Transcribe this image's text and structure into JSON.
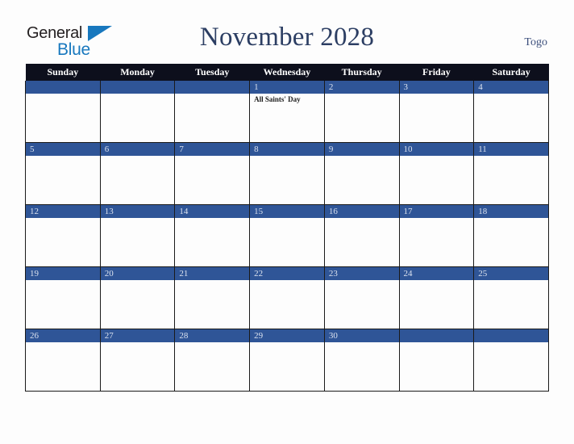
{
  "brand": {
    "name_part1": "General",
    "name_part2": "Blue",
    "logo_triangle_icon": "triangle-icon",
    "colors": {
      "general_text": "#231f20",
      "blue_text": "#1878be",
      "triangle": "#1878be"
    }
  },
  "header": {
    "title": "November 2028",
    "region": "Togo",
    "title_color": "#2c3e63",
    "region_color": "#3c4f7c"
  },
  "calendar": {
    "month": "November",
    "year": "2028",
    "weekday_headers": [
      "Sunday",
      "Monday",
      "Tuesday",
      "Wednesday",
      "Thursday",
      "Friday",
      "Saturday"
    ],
    "colors": {
      "header_background": "#0d0f1c",
      "header_text": "#ffffff",
      "daybar_background": "#2f5597",
      "daybar_text": "#dbe2ef",
      "cell_background": "#fdfdfd",
      "grid_line": "#1a1a1a",
      "event_text": "#1b1b1b"
    },
    "weeks": [
      [
        {
          "day": "",
          "events": []
        },
        {
          "day": "",
          "events": []
        },
        {
          "day": "",
          "events": []
        },
        {
          "day": "1",
          "events": [
            "All Saints' Day"
          ]
        },
        {
          "day": "2",
          "events": []
        },
        {
          "day": "3",
          "events": []
        },
        {
          "day": "4",
          "events": []
        }
      ],
      [
        {
          "day": "5",
          "events": []
        },
        {
          "day": "6",
          "events": []
        },
        {
          "day": "7",
          "events": []
        },
        {
          "day": "8",
          "events": []
        },
        {
          "day": "9",
          "events": []
        },
        {
          "day": "10",
          "events": []
        },
        {
          "day": "11",
          "events": []
        }
      ],
      [
        {
          "day": "12",
          "events": []
        },
        {
          "day": "13",
          "events": []
        },
        {
          "day": "14",
          "events": []
        },
        {
          "day": "15",
          "events": []
        },
        {
          "day": "16",
          "events": []
        },
        {
          "day": "17",
          "events": []
        },
        {
          "day": "18",
          "events": []
        }
      ],
      [
        {
          "day": "19",
          "events": []
        },
        {
          "day": "20",
          "events": []
        },
        {
          "day": "21",
          "events": []
        },
        {
          "day": "22",
          "events": []
        },
        {
          "day": "23",
          "events": []
        },
        {
          "day": "24",
          "events": []
        },
        {
          "day": "25",
          "events": []
        }
      ],
      [
        {
          "day": "26",
          "events": []
        },
        {
          "day": "27",
          "events": []
        },
        {
          "day": "28",
          "events": []
        },
        {
          "day": "29",
          "events": []
        },
        {
          "day": "30",
          "events": []
        },
        {
          "day": "",
          "events": []
        },
        {
          "day": "",
          "events": []
        }
      ]
    ]
  }
}
